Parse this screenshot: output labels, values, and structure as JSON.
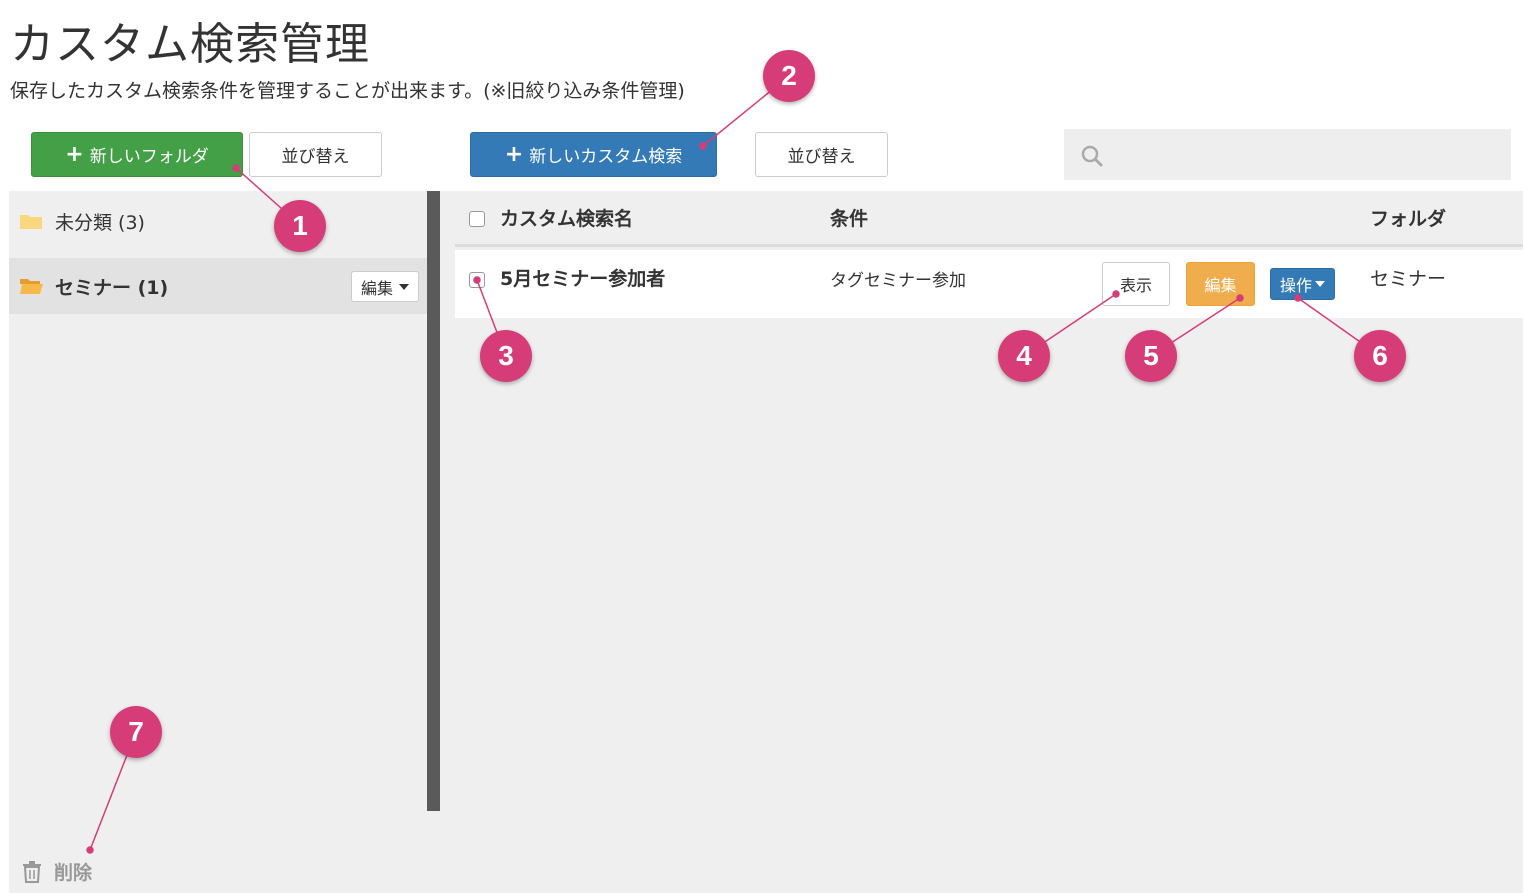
{
  "page": {
    "title": "カスタム検索管理",
    "subtitle": "保存したカスタム検索条件を管理することが出来ます。(※旧絞り込み条件管理)"
  },
  "toolbar": {
    "new_folder_label": "新しいフォルダ",
    "folder_sort_label": "並び替え",
    "new_search_label": "新しいカスタム検索",
    "search_sort_label": "並び替え",
    "search_placeholder": ""
  },
  "folders": [
    {
      "label": "未分類 (3)",
      "active": false
    },
    {
      "label": "セミナー (1)",
      "active": true,
      "edit_label": "編集"
    }
  ],
  "table": {
    "headers": {
      "name": "カスタム検索名",
      "condition": "条件",
      "folder": "フォルダ"
    },
    "rows": [
      {
        "name": "5月セミナー参加者",
        "condition": "タグセミナー参加",
        "folder": "セミナー",
        "view_label": "表示",
        "edit_label": "編集",
        "ops_label": "操作"
      }
    ]
  },
  "delete_label": "削除",
  "annotations": [
    "1",
    "2",
    "3",
    "4",
    "5",
    "6",
    "7"
  ],
  "colors": {
    "green": "#43a047",
    "blue": "#337ab7",
    "orange": "#f0ad4e",
    "badge": "#d63c78",
    "folder": "#f6c24a"
  }
}
